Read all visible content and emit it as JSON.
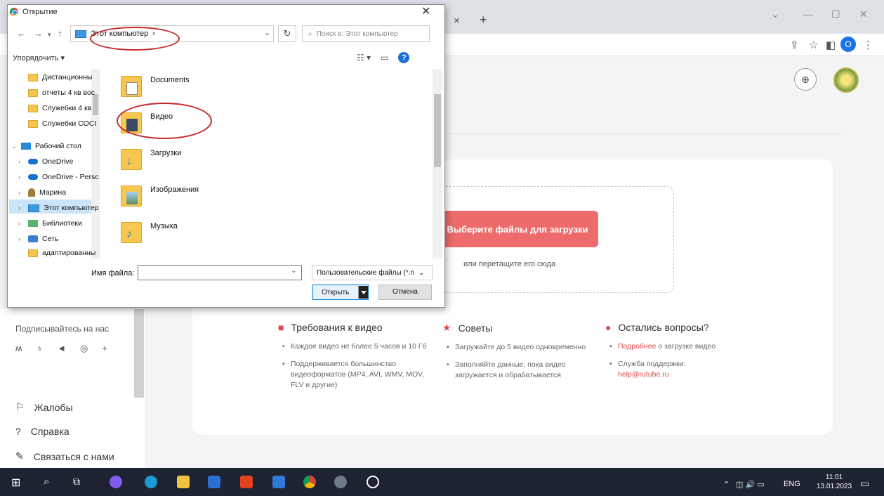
{
  "browser": {
    "tab_close": "×",
    "tab_new": "+",
    "profile_initial": "O"
  },
  "dialog": {
    "title": "Открытие",
    "path": "Этот компьютер",
    "path_sep": "›",
    "search_placeholder": "Поиск в: Этот компьютер",
    "organize": "Упорядочить ▾",
    "tree": [
      {
        "label": "Дистанционны",
        "icon": "folder-icon"
      },
      {
        "label": "отчеты 4 кв вос",
        "icon": "folder-icon"
      },
      {
        "label": "Служебки 4 кв",
        "icon": "folder-icon"
      },
      {
        "label": "Служебки СОСІ",
        "icon": "folder-icon"
      },
      {
        "label": "Рабочий стол",
        "icon": "desktop-icon"
      },
      {
        "label": "OneDrive",
        "icon": "onedrive-icon"
      },
      {
        "label": "OneDrive - Persc",
        "icon": "onedrive-icon"
      },
      {
        "label": "Марина",
        "icon": "user-icon"
      },
      {
        "label": "Этот компьютер",
        "icon": "computer-icon"
      },
      {
        "label": "Библиотеки",
        "icon": "library-icon"
      },
      {
        "label": "Сеть",
        "icon": "network-icon"
      },
      {
        "label": "адаптированны",
        "icon": "folder-icon"
      }
    ],
    "files": [
      {
        "label": "Documents",
        "icon": "documents-folder-icon"
      },
      {
        "label": "Видео",
        "icon": "video-folder-icon"
      },
      {
        "label": "Загрузки",
        "icon": "downloads-folder-icon"
      },
      {
        "label": "Изображения",
        "icon": "pictures-folder-icon"
      },
      {
        "label": "Музыка",
        "icon": "music-folder-icon"
      }
    ],
    "filename_label": "Имя файла:",
    "filename_value": "",
    "filter": "Пользовательские файлы (*.n",
    "open_label": "Открыть",
    "cancel_label": "Отмена"
  },
  "upload": {
    "button": "Выберите файлы для загрузки",
    "hint": "или перетащите его сюда"
  },
  "info": {
    "requirements": {
      "title": "Требования к видео",
      "items": [
        "Каждое видео не более 5 часов и 10 Гб",
        "Поддерживается большинство видеоформатов (MP4, AVI, WMV, MOV, FLV и другие)"
      ]
    },
    "tips": {
      "title": "Советы",
      "items": [
        "Загружайте до 5 видео одновременно",
        "Заполняйте данные, пока видео загружается и обрабатывается"
      ]
    },
    "questions": {
      "title": "Остались вопросы?",
      "more_link": "Подробнее",
      "more_rest": " о загрузке видео",
      "support": "Служба поддержки:",
      "email": "help@rutube.ru"
    }
  },
  "sidebar": {
    "subscribe": "Подписывайтесь на нас",
    "social": [
      "vk",
      "ok",
      "telegram",
      "viber",
      "+"
    ],
    "links": [
      "Жалобы",
      "Справка",
      "Связаться с нами"
    ]
  },
  "taskbar": {
    "lang": "ENG",
    "time": "11:01",
    "date": "13.01.2023"
  },
  "colors": {
    "accent_red": "#ee6b6b",
    "annotation": "#c52a2a",
    "taskbar": "#1d2331"
  }
}
